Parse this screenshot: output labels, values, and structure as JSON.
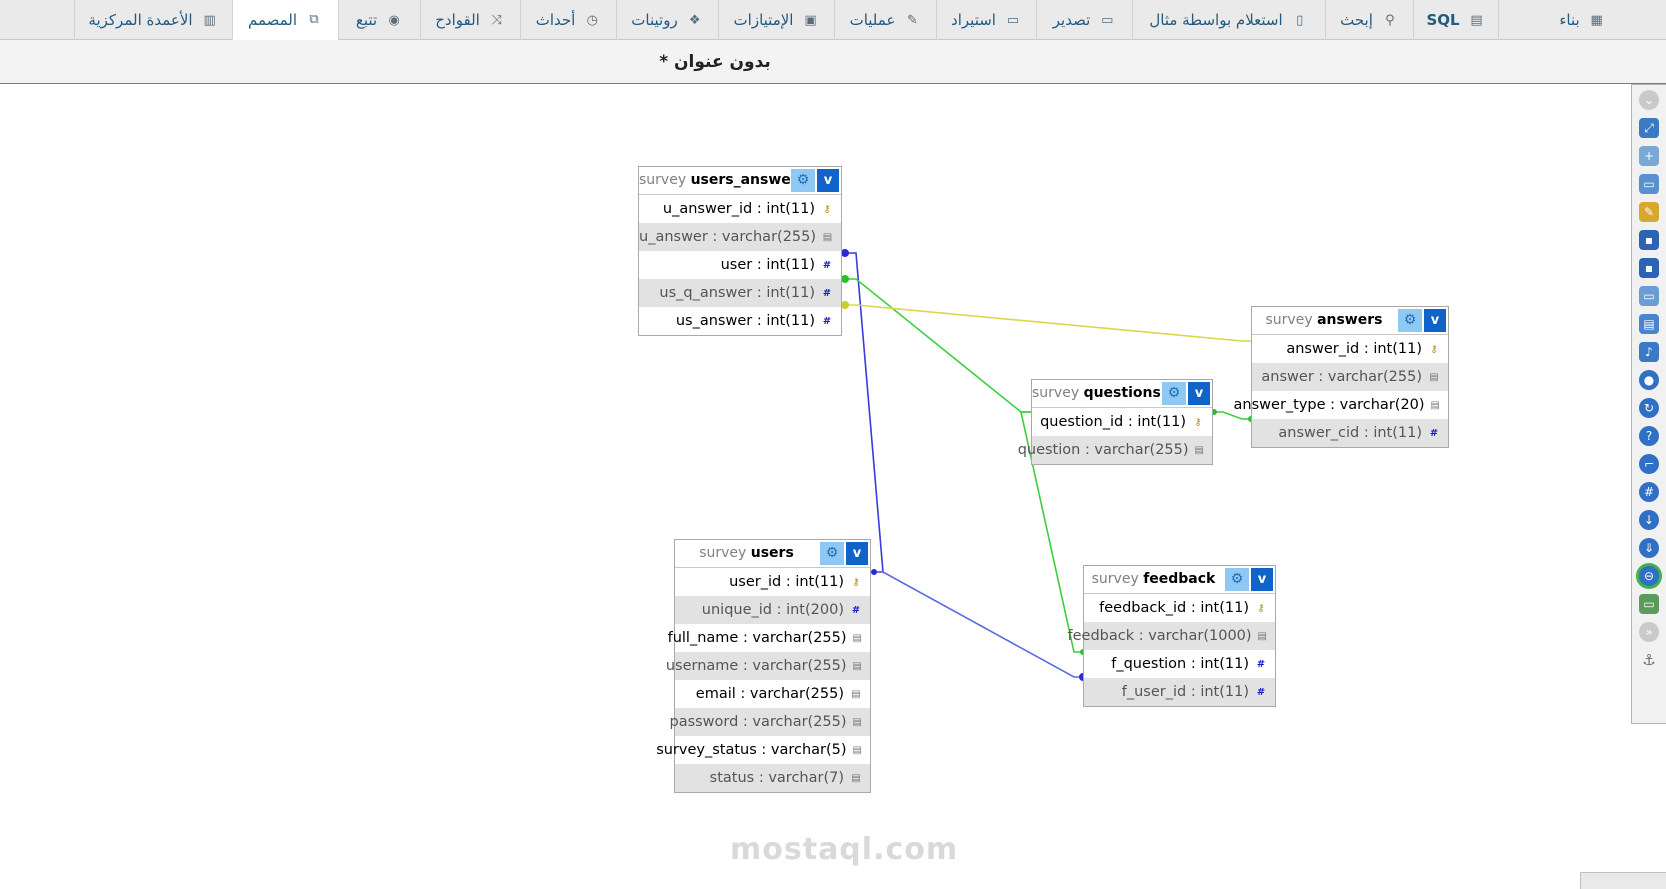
{
  "tabs": [
    {
      "label": "بناء",
      "icon": "structure-icon"
    },
    {
      "label": "SQL",
      "icon": "sql-icon"
    },
    {
      "label": "إبحث",
      "icon": "search-icon"
    },
    {
      "label": "استعلام بواسطة مثال",
      "icon": "query-icon"
    },
    {
      "label": "تصدير",
      "icon": "export-icon"
    },
    {
      "label": "استيراد",
      "icon": "import-icon"
    },
    {
      "label": "عمليات",
      "icon": "wrench-icon"
    },
    {
      "label": "الإمتيازات",
      "icon": "privileges-icon"
    },
    {
      "label": "روتينات",
      "icon": "routines-icon"
    },
    {
      "label": "أحداث",
      "icon": "clock-icon"
    },
    {
      "label": "القوادح",
      "icon": "triggers-icon"
    },
    {
      "label": "تتبع",
      "icon": "eye-icon"
    },
    {
      "label": "المصمم",
      "icon": "designer-icon",
      "active": true
    },
    {
      "label": "الأعمدة المركزية",
      "icon": "central-columns-icon"
    }
  ],
  "designer": {
    "title": "بدون عنوان *"
  },
  "tables": {
    "users_answers": {
      "db": "survey",
      "name": "users_answers",
      "columns": [
        "u_answer_id : int(11)",
        "u_answer : varchar(255)",
        "user : int(11)",
        "us_q_answer : int(11)",
        "us_answer : int(11)"
      ]
    },
    "answers": {
      "db": "survey",
      "name": "answers",
      "columns": [
        "answer_id : int(11)",
        "answer : varchar(255)",
        "answer_type : varchar(20)",
        "answer_cid : int(11)"
      ]
    },
    "questions": {
      "db": "survey",
      "name": "questions",
      "columns": [
        "question_id : int(11)",
        "question : varchar(255)"
      ]
    },
    "users": {
      "db": "survey",
      "name": "users",
      "columns": [
        "user_id : int(11)",
        "unique_id : int(200)",
        "full_name : varchar(255)",
        "username : varchar(255)",
        "email : varchar(255)",
        "password : varchar(255)",
        "survey_status : varchar(5)",
        "status : varchar(7)"
      ]
    },
    "feedback": {
      "db": "survey",
      "name": "feedback",
      "columns": [
        "feedback_id : int(11)",
        "feedback : varchar(1000)",
        "f_question : int(11)",
        "f_user_id : int(11)"
      ]
    }
  },
  "table_toggle_label": "v",
  "relation_colors": {
    "blue": "#3a3ae0",
    "green": "#3ccf3c",
    "yellow": "#d8d84a"
  },
  "toolbar_icons": [
    "toggle-menu-icon",
    "fullscreen-icon",
    "new-page-icon",
    "open-page-icon",
    "edit-page-icon",
    "save-icon",
    "save-as-icon",
    "export-schema-icon",
    "create-table-icon",
    "create-relation-icon",
    "pick-field-icon",
    "reload-icon",
    "help-icon",
    "angular-links-icon",
    "snap-grid-icon",
    "small-big-icon",
    "toggle-small-icon",
    "relation-lines-icon",
    "export-img-icon",
    "move-menu-icon",
    "pin-icon"
  ],
  "watermark": "mostaql.com"
}
